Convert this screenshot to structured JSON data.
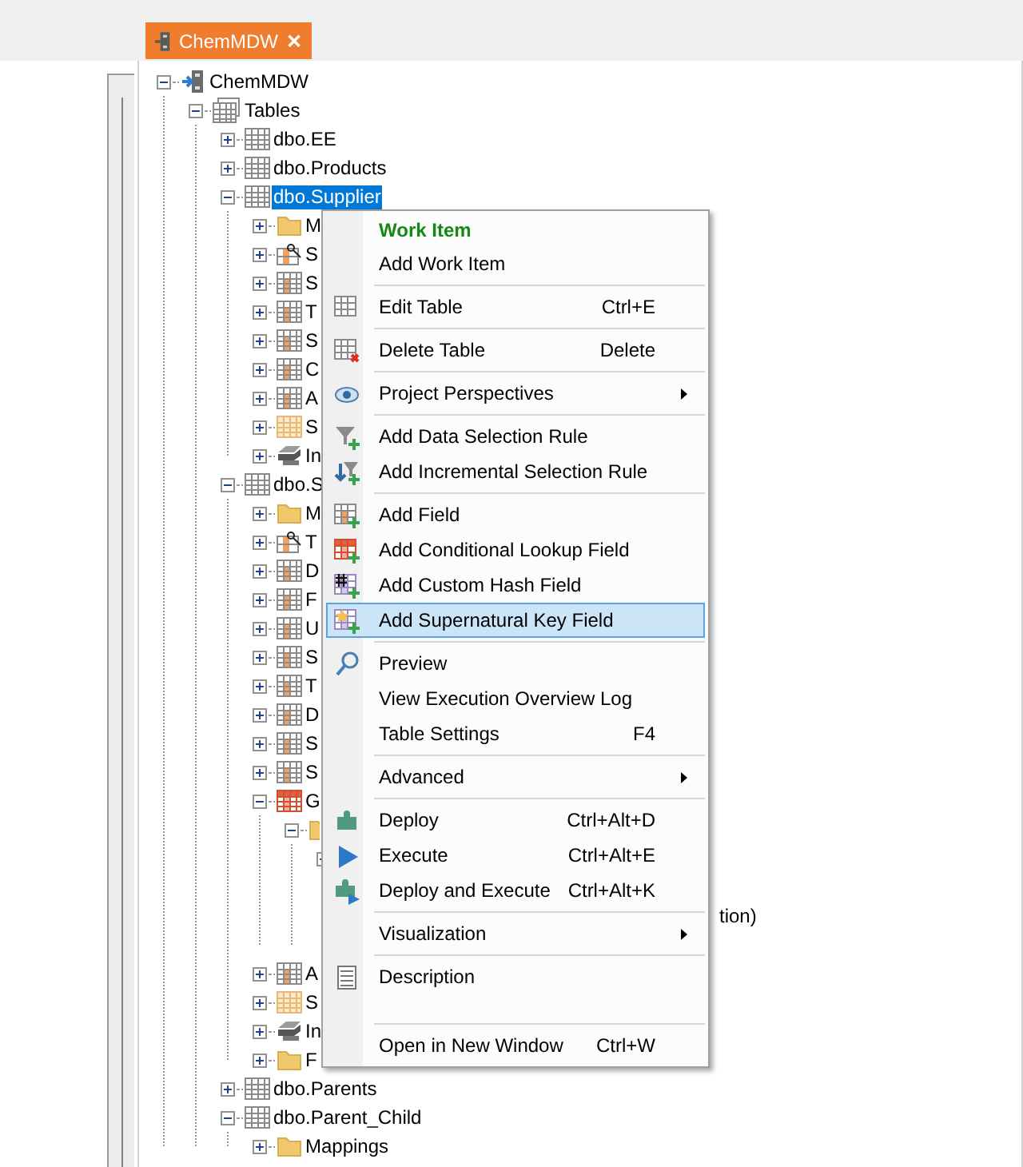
{
  "tab": {
    "title": "ChemMDW",
    "close": "✕"
  },
  "tree": [
    {
      "label": "ChemMDW",
      "kind": "database",
      "expanded": true,
      "selected": false,
      "children": [
        {
          "label": "Tables",
          "kind": "tables",
          "expanded": true,
          "selected": false,
          "children": [
            {
              "label": "dbo.EE",
              "kind": "table",
              "expanded": false,
              "selected": false
            },
            {
              "label": "dbo.Products",
              "kind": "table",
              "expanded": false,
              "selected": false
            },
            {
              "label": "dbo.Supplier",
              "kind": "table",
              "expanded": true,
              "selected": true,
              "children": [
                {
                  "label": "M",
                  "kind": "folder",
                  "expanded": false,
                  "selected": false
                },
                {
                  "label": "S",
                  "kind": "key-table",
                  "expanded": false,
                  "selected": false
                },
                {
                  "label": "S",
                  "kind": "field-table",
                  "expanded": false,
                  "selected": false
                },
                {
                  "label": "T",
                  "kind": "field-table",
                  "expanded": false,
                  "selected": false
                },
                {
                  "label": "S",
                  "kind": "field-table",
                  "expanded": false,
                  "selected": false
                },
                {
                  "label": "C",
                  "kind": "field-table",
                  "expanded": false,
                  "selected": false
                },
                {
                  "label": "A",
                  "kind": "field-table",
                  "expanded": false,
                  "selected": false
                },
                {
                  "label": "S",
                  "kind": "light-table",
                  "expanded": false,
                  "selected": false
                },
                {
                  "label": "In",
                  "kind": "layers",
                  "expanded": false,
                  "selected": false
                }
              ]
            },
            {
              "label": "dbo.S",
              "kind": "table",
              "expanded": true,
              "selected": false,
              "children": [
                {
                  "label": "M",
                  "kind": "folder",
                  "expanded": false,
                  "selected": false
                },
                {
                  "label": "T",
                  "kind": "key-table",
                  "expanded": false,
                  "selected": false
                },
                {
                  "label": "D",
                  "kind": "field-table",
                  "expanded": false,
                  "selected": false
                },
                {
                  "label": "F",
                  "kind": "field-table",
                  "expanded": false,
                  "selected": false
                },
                {
                  "label": "U",
                  "kind": "field-table",
                  "expanded": false,
                  "selected": false
                },
                {
                  "label": "S",
                  "kind": "field-table",
                  "expanded": false,
                  "selected": false
                },
                {
                  "label": "T",
                  "kind": "field-table",
                  "expanded": false,
                  "selected": false
                },
                {
                  "label": "D",
                  "kind": "field-table",
                  "expanded": false,
                  "selected": false
                },
                {
                  "label": "S",
                  "kind": "field-table",
                  "expanded": false,
                  "selected": false
                },
                {
                  "label": "S",
                  "kind": "field-table",
                  "expanded": false,
                  "selected": false
                },
                {
                  "label": "G",
                  "kind": "red-table",
                  "expanded": true,
                  "selected": false,
                  "children": [
                    {
                      "kind": "folder",
                      "expanded": true,
                      "children": [
                        {
                          "kind": "hidden",
                          "expanded": false
                        },
                        {
                          "kind": "hidden"
                        },
                        {
                          "kind": "overflow",
                          "label": "tion)"
                        },
                        {
                          "kind": "hidden"
                        }
                      ]
                    }
                  ]
                },
                {
                  "label": "A",
                  "kind": "field-table",
                  "expanded": false,
                  "selected": false
                },
                {
                  "label": "S",
                  "kind": "light-table",
                  "expanded": false,
                  "selected": false
                },
                {
                  "label": "In",
                  "kind": "layers",
                  "expanded": false,
                  "selected": false
                },
                {
                  "label": "F",
                  "kind": "folder",
                  "expanded": false,
                  "selected": false
                }
              ]
            },
            {
              "label": "dbo.Parents",
              "kind": "table",
              "expanded": false,
              "selected": false
            },
            {
              "label": "dbo.Parent_Child",
              "kind": "table",
              "expanded": true,
              "selected": false,
              "children": [
                {
                  "label": "Mappings",
                  "kind": "folder",
                  "expanded": false,
                  "selected": false
                }
              ]
            }
          ]
        }
      ]
    }
  ],
  "menu": [
    {
      "kind": "header",
      "label": "Work Item"
    },
    {
      "kind": "item",
      "label": "Add Work Item",
      "selected": false,
      "submenu": false
    },
    {
      "kind": "separator"
    },
    {
      "kind": "item",
      "label": "Edit Table",
      "shortcut": "Ctrl+E",
      "selected": false,
      "submenu": false
    },
    {
      "kind": "separator"
    },
    {
      "kind": "item",
      "label": "Delete Table",
      "shortcut": "Delete",
      "selected": false,
      "submenu": false
    },
    {
      "kind": "separator"
    },
    {
      "kind": "item",
      "label": "Project Perspectives",
      "selected": false,
      "submenu": true
    },
    {
      "kind": "separator"
    },
    {
      "kind": "item",
      "label": "Add Data Selection Rule",
      "selected": false,
      "submenu": false
    },
    {
      "kind": "item",
      "label": "Add Incremental Selection Rule",
      "selected": false,
      "submenu": false
    },
    {
      "kind": "separator"
    },
    {
      "kind": "item",
      "label": "Add Field",
      "selected": false,
      "submenu": false
    },
    {
      "kind": "item",
      "label": "Add Conditional Lookup Field",
      "selected": false,
      "submenu": false
    },
    {
      "kind": "item",
      "label": "Add Custom Hash Field",
      "selected": false,
      "submenu": false
    },
    {
      "kind": "item",
      "label": "Add Supernatural Key Field",
      "selected": true,
      "submenu": false
    },
    {
      "kind": "separator"
    },
    {
      "kind": "item",
      "label": "Preview",
      "selected": false,
      "submenu": false
    },
    {
      "kind": "item",
      "label": "View Execution Overview Log",
      "selected": false,
      "submenu": false
    },
    {
      "kind": "item",
      "label": "Table Settings",
      "shortcut": "F4",
      "selected": false,
      "submenu": false
    },
    {
      "kind": "separator"
    },
    {
      "kind": "item",
      "label": "Advanced",
      "selected": false,
      "submenu": true
    },
    {
      "kind": "separator"
    },
    {
      "kind": "item",
      "label": "Deploy",
      "shortcut": "Ctrl+Alt+D",
      "selected": false,
      "submenu": false
    },
    {
      "kind": "item",
      "label": "Execute",
      "shortcut": "Ctrl+Alt+E",
      "selected": false,
      "submenu": false
    },
    {
      "kind": "item",
      "label": "Deploy and Execute",
      "shortcut": "Ctrl+Alt+K",
      "selected": false,
      "submenu": false
    },
    {
      "kind": "separator"
    },
    {
      "kind": "item",
      "label": "Visualization",
      "selected": false,
      "submenu": true
    },
    {
      "kind": "separator"
    },
    {
      "kind": "item",
      "label": "Description",
      "selected": false,
      "submenu": false
    },
    {
      "kind": "blank"
    },
    {
      "kind": "separator"
    },
    {
      "kind": "item",
      "label": "Open in New Window",
      "shortcut": "Ctrl+W",
      "selected": false,
      "submenu": false
    }
  ]
}
